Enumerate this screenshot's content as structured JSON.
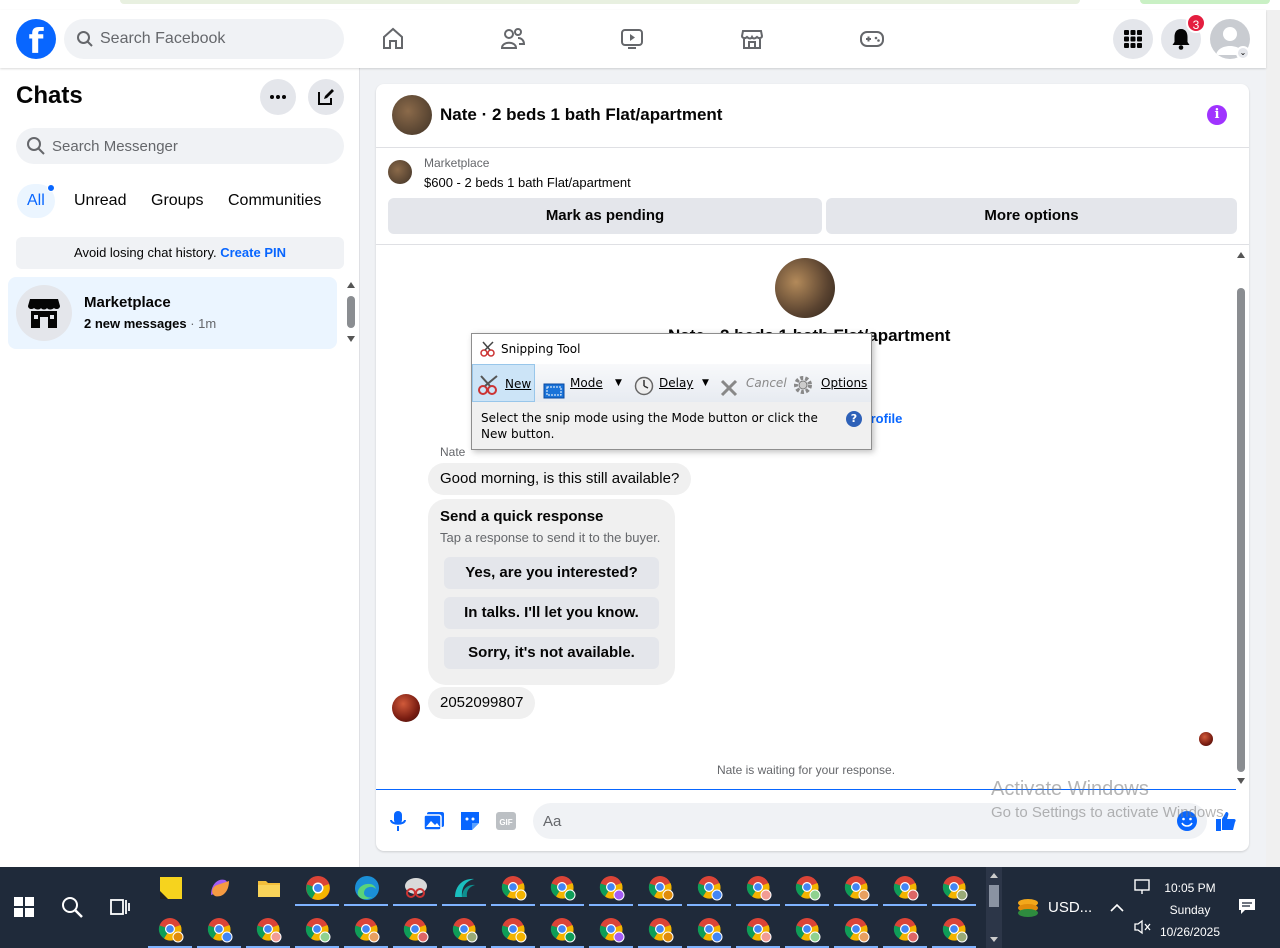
{
  "header": {
    "logo": "f",
    "search_placeholder": "Search Facebook",
    "notification_count": "3"
  },
  "sidebar": {
    "title": "Chats",
    "search_placeholder": "Search Messenger",
    "filters": [
      "All",
      "Unread",
      "Groups",
      "Communities"
    ],
    "pin_notice": "Avoid losing chat history.",
    "pin_link": "Create PIN",
    "chats": [
      {
        "name": "Marketplace",
        "preview": "2 new messages",
        "time": " · 1m"
      }
    ]
  },
  "conversation": {
    "title": "Nate · 2 beds 1 bath Flat/apartment",
    "marketplace_label": "Marketplace",
    "listing": "$600 - 2 beds 1 bath Flat/apartment",
    "mark_pending": "Mark as pending",
    "more_options": "More options",
    "center_title": "Nate · 2 beds 1 bath Flat/apartment",
    "profile_link": "r profile",
    "sender": "Nate",
    "messages": [
      "Good morning, is this still available?",
      "2052099807"
    ],
    "quick_response": {
      "title": "Send a quick response",
      "subtitle": "Tap a response to send it to the buyer.",
      "options": [
        "Yes, are you interested?",
        "In talks. I'll let you know.",
        "Sorry, it's not available."
      ]
    },
    "waiting": "Nate is waiting for your response.",
    "composer_placeholder": "Aa"
  },
  "snipping_tool": {
    "title": "Snipping Tool",
    "new": "New",
    "mode": "Mode",
    "delay": "Delay",
    "cancel": "Cancel",
    "options": "Options",
    "message": "Select the snip mode using the Mode button or click the New button.",
    "help": "?"
  },
  "watermark": {
    "line1": "Activate Windows",
    "line2": "Go to Settings to activate Windows."
  },
  "taskbar": {
    "tray_app": "USD...",
    "time": "10:05 PM",
    "day": "Sunday",
    "date": "10/26/2025"
  },
  "colors": {
    "facebook_blue": "#0866ff",
    "selected_chat": "#ebf5ff",
    "info_purple": "#a033ff",
    "badge_red": "#e41e3f",
    "taskbar": "#1f2a3a"
  }
}
